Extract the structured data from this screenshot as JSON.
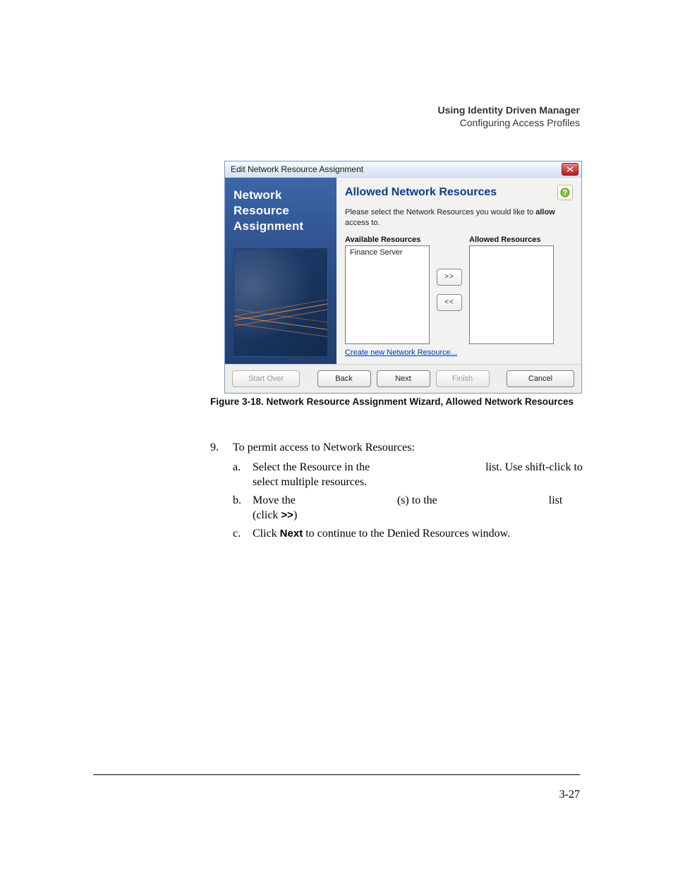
{
  "header": {
    "title": "Using Identity Driven Manager",
    "subtitle": "Configuring Access Profiles"
  },
  "dialog": {
    "title": "Edit Network Resource Assignment",
    "sidebar_title": "Network Resource Assignment",
    "main_heading": "Allowed Network Resources",
    "instruction_pre": "Please select the Network Resources you would like to ",
    "instruction_bold": "allow",
    "instruction_post": " access to.",
    "available_label": "Available Resources",
    "allowed_label": "Allowed Resources",
    "available_items": [
      "Finance Server"
    ],
    "allowed_items": [],
    "move_right": ">>",
    "move_left": "<<",
    "create_link": "Create new Network Resource...",
    "buttons": {
      "start_over": "Start Over",
      "back": "Back",
      "next": "Next",
      "finish": "Finish",
      "cancel": "Cancel"
    }
  },
  "figure_caption": "Figure 3-18. Network Resource Assignment Wizard, Allowed Network Resources",
  "instructions": {
    "num": "9.",
    "lead": "To permit access to Network Resources:",
    "a_pre": "Select the Resource in the ",
    "a_gap_after": " list. Use shift-click to select multiple resources.",
    "b_pre": "Move the ",
    "b_mid": "(s) to the ",
    "b_end": " list",
    "b_click_pre": "(click  ",
    "b_click_sym": ">>",
    "b_click_post": ")",
    "c_pre": "Click ",
    "c_bold": "Next",
    "c_post": " to continue to the Denied Resources window."
  },
  "page_number": "3-27"
}
